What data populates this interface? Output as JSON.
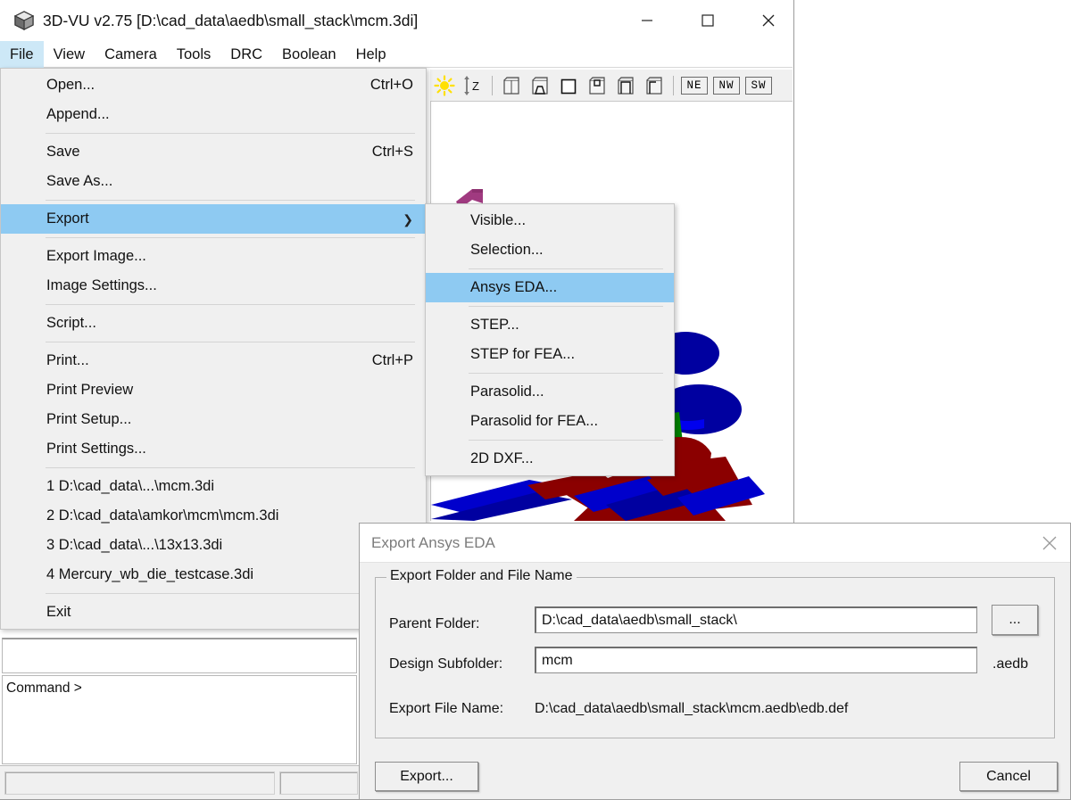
{
  "app": {
    "title": "3D-VU v2.75 [D:\\cad_data\\aedb\\small_stack\\mcm.3di]",
    "icon": "cube-icon",
    "window_controls": {
      "minimize": "minimize-icon",
      "maximize": "maximize-icon",
      "close": "close-icon"
    }
  },
  "menubar": {
    "items": [
      {
        "label": "File",
        "active": true
      },
      {
        "label": "View",
        "active": false
      },
      {
        "label": "Camera",
        "active": false
      },
      {
        "label": "Tools",
        "active": false
      },
      {
        "label": "DRC",
        "active": false
      },
      {
        "label": "Boolean",
        "active": false
      },
      {
        "label": "Help",
        "active": false
      }
    ]
  },
  "toolbar": {
    "items": [
      {
        "name": "light-sun-icon",
        "kind": "icon"
      },
      {
        "name": "z-scale-icon",
        "kind": "icon"
      },
      {
        "name": "separator",
        "kind": "sep"
      },
      {
        "name": "view-box-1-icon",
        "kind": "icon"
      },
      {
        "name": "view-box-2-icon",
        "kind": "icon"
      },
      {
        "name": "view-box-3-icon",
        "kind": "icon"
      },
      {
        "name": "view-box-4-icon",
        "kind": "icon"
      },
      {
        "name": "view-box-5-icon",
        "kind": "icon"
      },
      {
        "name": "view-box-6-icon",
        "kind": "icon"
      },
      {
        "name": "separator",
        "kind": "sep"
      },
      {
        "name": "view-ne-button",
        "kind": "label",
        "label": "NE"
      },
      {
        "name": "view-nw-button",
        "kind": "label",
        "label": "NW"
      },
      {
        "name": "view-sw-button",
        "kind": "label",
        "label": "SW"
      }
    ]
  },
  "file_menu": {
    "items": [
      {
        "type": "item",
        "label": "Open...",
        "accel": "Ctrl+O",
        "name": "menu-open"
      },
      {
        "type": "item",
        "label": "Append...",
        "accel": "",
        "name": "menu-append"
      },
      {
        "type": "sep"
      },
      {
        "type": "item",
        "label": "Save",
        "accel": "Ctrl+S",
        "name": "menu-save"
      },
      {
        "type": "item",
        "label": "Save As...",
        "accel": "",
        "name": "menu-save-as"
      },
      {
        "type": "sep"
      },
      {
        "type": "item",
        "label": "Export",
        "accel": "",
        "submenu": true,
        "selected": true,
        "name": "menu-export"
      },
      {
        "type": "sep"
      },
      {
        "type": "item",
        "label": "Export Image...",
        "accel": "",
        "name": "menu-export-image"
      },
      {
        "type": "item",
        "label": "Image Settings...",
        "accel": "",
        "name": "menu-image-settings"
      },
      {
        "type": "sep"
      },
      {
        "type": "item",
        "label": "Script...",
        "accel": "",
        "name": "menu-script"
      },
      {
        "type": "sep"
      },
      {
        "type": "item",
        "label": "Print...",
        "accel": "Ctrl+P",
        "name": "menu-print"
      },
      {
        "type": "item",
        "label": "Print Preview",
        "accel": "",
        "name": "menu-print-preview"
      },
      {
        "type": "item",
        "label": "Print Setup...",
        "accel": "",
        "name": "menu-print-setup"
      },
      {
        "type": "item",
        "label": "Print Settings...",
        "accel": "",
        "name": "menu-print-settings"
      },
      {
        "type": "sep"
      },
      {
        "type": "item",
        "label": "1 D:\\cad_data\\...\\mcm.3di",
        "accel": "",
        "name": "menu-recent-1"
      },
      {
        "type": "item",
        "label": "2 D:\\cad_data\\amkor\\mcm\\mcm.3di",
        "accel": "",
        "name": "menu-recent-2"
      },
      {
        "type": "item",
        "label": "3 D:\\cad_data\\...\\13x13.3di",
        "accel": "",
        "name": "menu-recent-3"
      },
      {
        "type": "item",
        "label": "4 Mercury_wb_die_testcase.3di",
        "accel": "",
        "name": "menu-recent-4"
      },
      {
        "type": "sep"
      },
      {
        "type": "item",
        "label": "Exit",
        "accel": "",
        "name": "menu-exit"
      }
    ]
  },
  "export_submenu": {
    "items": [
      {
        "type": "item",
        "label": "Visible...",
        "name": "submenu-visible"
      },
      {
        "type": "item",
        "label": "Selection...",
        "name": "submenu-selection"
      },
      {
        "type": "sep"
      },
      {
        "type": "item",
        "label": "Ansys EDA...",
        "selected": true,
        "name": "submenu-ansys-eda"
      },
      {
        "type": "sep"
      },
      {
        "type": "item",
        "label": "STEP...",
        "name": "submenu-step"
      },
      {
        "type": "item",
        "label": "STEP for FEA...",
        "name": "submenu-step-for-fea"
      },
      {
        "type": "sep"
      },
      {
        "type": "item",
        "label": "Parasolid...",
        "name": "submenu-parasolid"
      },
      {
        "type": "item",
        "label": "Parasolid for FEA...",
        "name": "submenu-parasolid-for-fea"
      },
      {
        "type": "sep"
      },
      {
        "type": "item",
        "label": "2D DXF...",
        "name": "submenu-2d-dxf"
      }
    ]
  },
  "command_pane": {
    "prompt": "Command >"
  },
  "dialog": {
    "title": "Export Ansys EDA",
    "close_icon": "close-icon",
    "group_legend": "Export Folder and File Name",
    "parent_folder_label": "Parent Folder:",
    "parent_folder_value": "D:\\cad_data\\aedb\\small_stack\\",
    "browse_button": "...",
    "design_subfolder_label": "Design Subfolder:",
    "design_subfolder_value": "mcm",
    "aedb_suffix": ".aedb",
    "export_file_name_label": "Export File Name:",
    "export_file_name_value": "D:\\cad_data\\aedb\\small_stack\\mcm.aedb\\edb.def",
    "export_button": "Export...",
    "cancel_button": "Cancel"
  },
  "colors": {
    "menu_highlight": "#8ecaf2",
    "menubar_active": "#cde8f7",
    "dialog_bg": "#f0f0f0",
    "model_blue": "#0000a0",
    "model_dark_red": "#8b0000",
    "model_green": "#008000",
    "model_magenta": "#a03a80",
    "model_bright_blue": "#0000ee"
  }
}
